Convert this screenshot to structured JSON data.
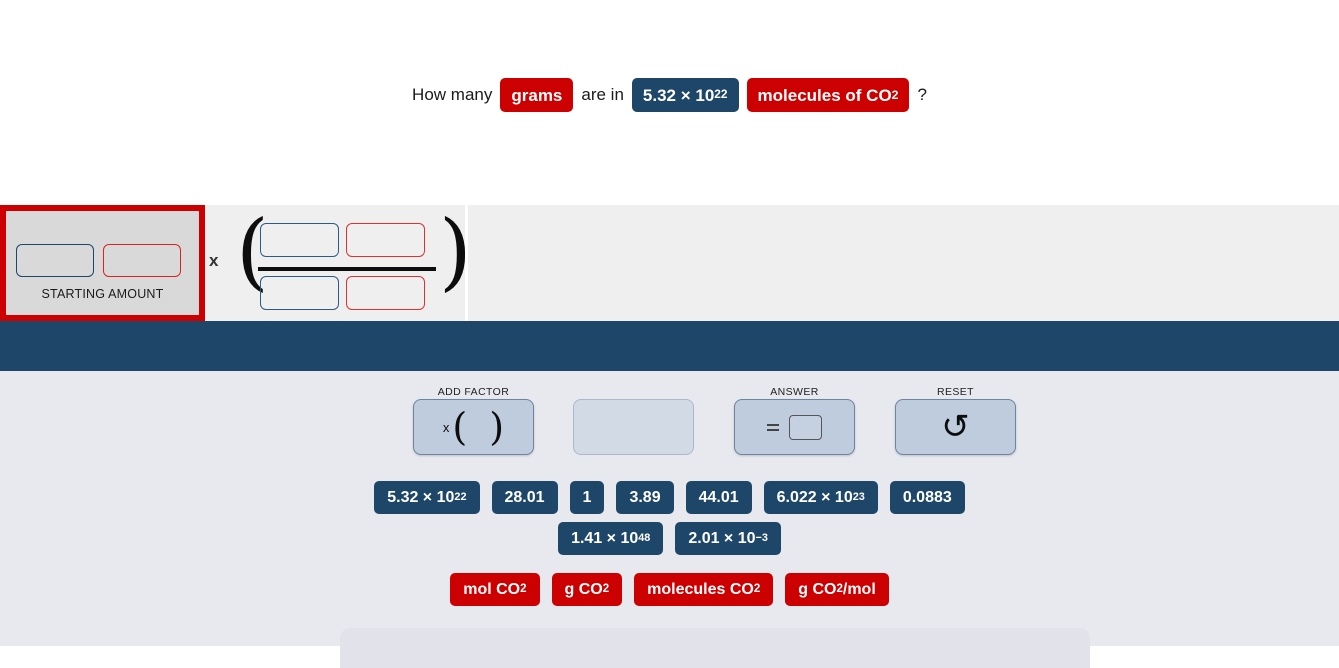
{
  "question": {
    "prefix": "How many",
    "quantity_unit": "grams",
    "middle": "are in",
    "amount_mantissa": "5.32 × 10",
    "amount_exponent": "22",
    "substance_prefix": "molecules of CO",
    "substance_sub": "2",
    "suffix": "?"
  },
  "work_area": {
    "starting_amount_label": "STARTING AMOUNT",
    "times_symbol": "x",
    "starting_value_box": "",
    "starting_unit_box": "",
    "numerator_value_box": "",
    "numerator_unit_box": "",
    "denominator_value_box": "",
    "denominator_unit_box": ""
  },
  "toolbar": {
    "add_factor_label": "ADD FACTOR",
    "add_factor_glyph": "x ( )",
    "blank_label": "",
    "answer_label": "ANSWER",
    "answer_glyph": "=",
    "reset_label": "RESET",
    "reset_glyph": "↺"
  },
  "tiles": {
    "numbers_row_1": [
      {
        "mantissa": "5.32 × 10",
        "exponent": "22"
      },
      {
        "mantissa": "28.01",
        "exponent": ""
      },
      {
        "mantissa": "1",
        "exponent": ""
      },
      {
        "mantissa": "3.89",
        "exponent": ""
      },
      {
        "mantissa": "44.01",
        "exponent": ""
      },
      {
        "mantissa": "6.022 × 10",
        "exponent": "23"
      },
      {
        "mantissa": "0.0883",
        "exponent": ""
      }
    ],
    "numbers_row_2": [
      {
        "mantissa": "1.41 × 10",
        "exponent": "48"
      },
      {
        "mantissa": "2.01 × 10",
        "exponent": "−3"
      }
    ],
    "units_row": [
      {
        "pre": "mol CO",
        "sub": "2",
        "post": ""
      },
      {
        "pre": "g CO",
        "sub": "2",
        "post": ""
      },
      {
        "pre": "molecules CO",
        "sub": "2",
        "post": ""
      },
      {
        "pre": "g CO",
        "sub": "2",
        "post": "/mol"
      }
    ]
  },
  "colors": {
    "accent_red": "#cc0000",
    "accent_blue": "#1d4669",
    "band_blue": "#1d4669",
    "tray_bg": "#e8e9ef",
    "work_bg": "#efefef",
    "slot_bg": "#d9d9d9",
    "button_face": "#bfccdd"
  }
}
